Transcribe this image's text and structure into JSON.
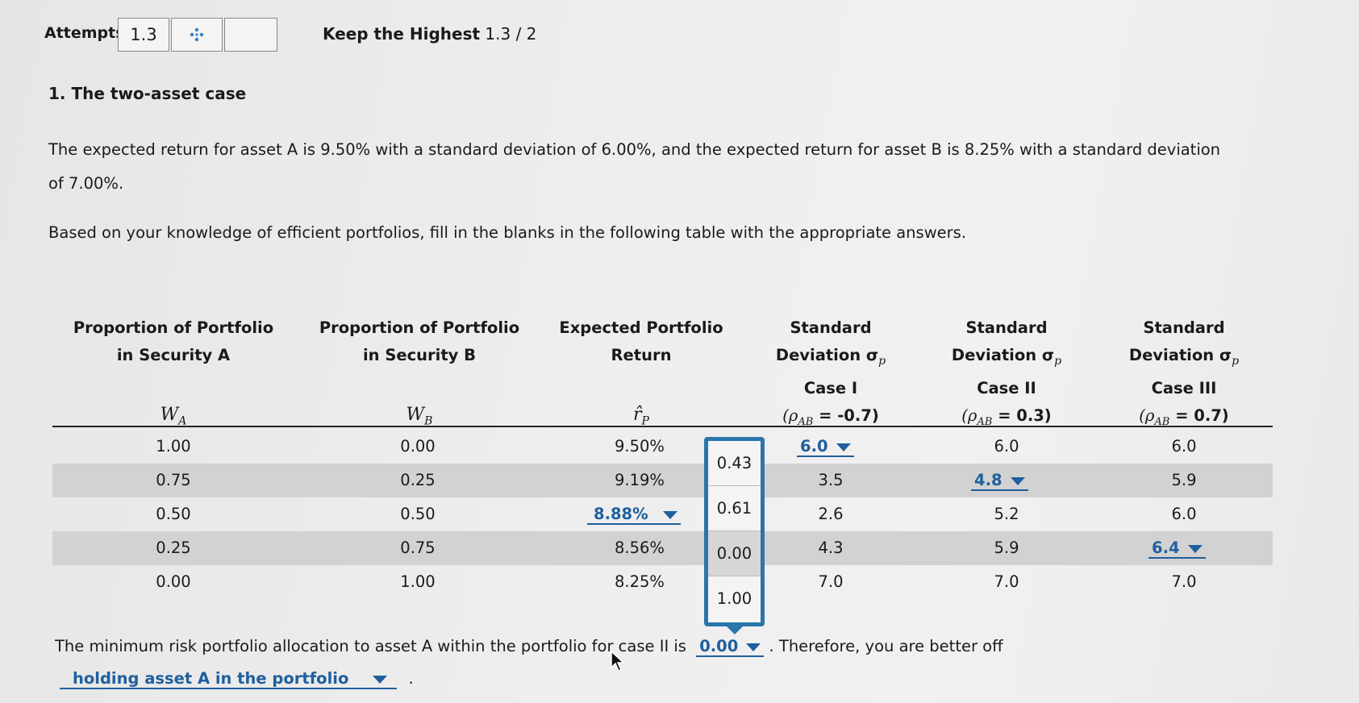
{
  "attempts": {
    "label": "Attempts",
    "value": "1.3",
    "icon": "move-icon",
    "keep": "Keep the Highest",
    "score": "1.3 / 2"
  },
  "question": {
    "title": "1. The two-asset case",
    "intro_line1": "The expected return for asset A is 9.50% with a standard deviation of 6.00%, and the expected return for asset B is 8.25% with a standard deviation",
    "intro_line2": "of 7.00%.",
    "instructions": "Based on your knowledge of efficient portfolios, fill in the blanks in the following table with the appropriate answers."
  },
  "table": {
    "headers": {
      "wa_1": "Proportion of Portfolio",
      "wa_2": "in Security A",
      "wa_sym": "W",
      "wa_sub": "A",
      "wb_1": "Proportion of Portfolio",
      "wb_2": "in Security B",
      "wb_sym": "W",
      "wb_sub": "B",
      "ret_1": "Expected Portfolio",
      "ret_2": "Return",
      "ret_sym": "r̂",
      "ret_sub": "P",
      "sd_1": "Standard",
      "sd_2": "Deviation σ",
      "sd_sub": "p",
      "case1": "Case I",
      "case1_rho": "(ρ",
      "case1_rho_sub": "AB",
      "case1_val": " = -0.7)",
      "case2": "Case II",
      "case2_rho": "(ρ",
      "case2_rho_sub": "AB",
      "case2_val": " = 0.3)",
      "case3": "Case III",
      "case3_rho": "(ρ",
      "case3_rho_sub": "AB",
      "case3_val": " = 0.7)"
    },
    "rows": [
      {
        "wa": "1.00",
        "wb": "0.00",
        "ret": "9.50%",
        "c1": "6.0",
        "c2": "6.0",
        "c3": "6.0"
      },
      {
        "wa": "0.75",
        "wb": "0.25",
        "ret": "9.19%",
        "c1": "3.5",
        "c2": "4.8",
        "c3": "5.9"
      },
      {
        "wa": "0.50",
        "wb": "0.50",
        "ret": "8.88%",
        "c1": "2.6",
        "c2": "5.2",
        "c3": "6.0"
      },
      {
        "wa": "0.25",
        "wb": "0.75",
        "ret": "8.56%",
        "c1": "4.3",
        "c2": "5.9",
        "c3": "6.4"
      },
      {
        "wa": "0.00",
        "wb": "1.00",
        "ret": "8.25%",
        "c1": "7.0",
        "c2": "7.0",
        "c3": "7.0"
      }
    ]
  },
  "popup_options": [
    "0.43",
    "0.61",
    "0.00",
    "1.00"
  ],
  "footer": {
    "sentence_start": "The minimum risk portfolio allocation to asset A within the portfolio for case II is",
    "dropdown_value": "0.00",
    "sentence_end": ". Therefore, you are better off",
    "dropdown2_value": "holding asset A in the portfolio",
    "period": "."
  }
}
